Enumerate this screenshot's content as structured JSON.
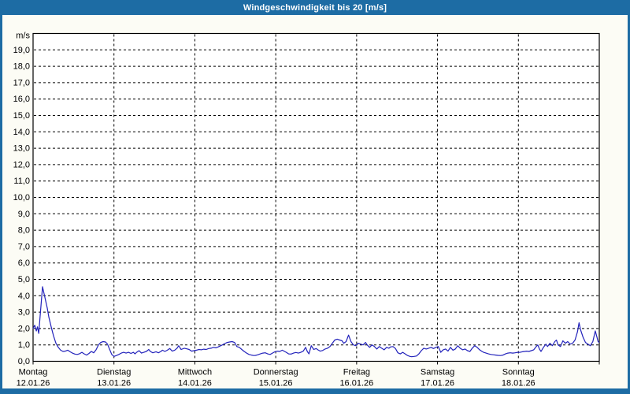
{
  "window": {
    "title": "Windgeschwindigkeit bis 20 [m/s]",
    "frame_color": "#1d6ca4",
    "content_background": "#fcfcf5"
  },
  "chart_data": {
    "type": "line",
    "title": "Windgeschwindigkeit bis 20 [m/s]",
    "unit_label": "m/s",
    "ylim": [
      0,
      20
    ],
    "y_tick_step": 1,
    "y_tick_labels": [
      "0,0",
      "1,0",
      "2,0",
      "3,0",
      "4,0",
      "5,0",
      "6,0",
      "7,0",
      "8,0",
      "9,0",
      "10,0",
      "11,0",
      "12,0",
      "13,0",
      "14,0",
      "15,0",
      "16,0",
      "17,0",
      "18,0",
      "19,0"
    ],
    "grid": "dashed",
    "legend_position": "none",
    "line_color": "#2222bb",
    "plot_background": "#ffffff",
    "x_days": [
      {
        "weekday": "Montag",
        "date": "12.01.26"
      },
      {
        "weekday": "Dienstag",
        "date": "13.01.26"
      },
      {
        "weekday": "Mittwoch",
        "date": "14.01.26"
      },
      {
        "weekday": "Donnerstag",
        "date": "15.01.26"
      },
      {
        "weekday": "Freitag",
        "date": "16.01.26"
      },
      {
        "weekday": "Samstag",
        "date": "17.01.26"
      },
      {
        "weekday": "Sonntag",
        "date": "18.01.26"
      }
    ],
    "series": [
      {
        "name": "Windgeschwindigkeit",
        "x_unit": "days_from_start",
        "y_unit": "m/s",
        "points": [
          [
            0.0,
            2.0
          ],
          [
            0.02,
            2.2
          ],
          [
            0.04,
            1.85
          ],
          [
            0.055,
            2.1
          ],
          [
            0.07,
            1.7
          ],
          [
            0.09,
            2.9
          ],
          [
            0.117,
            4.55
          ],
          [
            0.146,
            3.9
          ],
          [
            0.175,
            3.25
          ],
          [
            0.195,
            2.7
          ],
          [
            0.224,
            2.1
          ],
          [
            0.253,
            1.55
          ],
          [
            0.282,
            1.1
          ],
          [
            0.312,
            0.85
          ],
          [
            0.341,
            0.68
          ],
          [
            0.37,
            0.6
          ],
          [
            0.399,
            0.62
          ],
          [
            0.428,
            0.68
          ],
          [
            0.458,
            0.58
          ],
          [
            0.487,
            0.5
          ],
          [
            0.516,
            0.44
          ],
          [
            0.545,
            0.42
          ],
          [
            0.574,
            0.46
          ],
          [
            0.604,
            0.55
          ],
          [
            0.633,
            0.45
          ],
          [
            0.662,
            0.38
          ],
          [
            0.691,
            0.48
          ],
          [
            0.72,
            0.6
          ],
          [
            0.75,
            0.52
          ],
          [
            0.779,
            0.7
          ],
          [
            0.808,
            1.0
          ],
          [
            0.837,
            1.15
          ],
          [
            0.866,
            1.2
          ],
          [
            0.896,
            1.18
          ],
          [
            0.92,
            1.05
          ],
          [
            0.944,
            0.75
          ],
          [
            0.973,
            0.42
          ],
          [
            1.0,
            0.3
          ],
          [
            1.03,
            0.35
          ],
          [
            1.06,
            0.42
          ],
          [
            1.09,
            0.5
          ],
          [
            1.12,
            0.55
          ],
          [
            1.15,
            0.5
          ],
          [
            1.18,
            0.55
          ],
          [
            1.21,
            0.48
          ],
          [
            1.24,
            0.55
          ],
          [
            1.26,
            0.45
          ],
          [
            1.28,
            0.55
          ],
          [
            1.31,
            0.65
          ],
          [
            1.34,
            0.5
          ],
          [
            1.37,
            0.55
          ],
          [
            1.4,
            0.6
          ],
          [
            1.43,
            0.72
          ],
          [
            1.45,
            0.6
          ],
          [
            1.48,
            0.52
          ],
          [
            1.52,
            0.58
          ],
          [
            1.55,
            0.52
          ],
          [
            1.58,
            0.6
          ],
          [
            1.6,
            0.68
          ],
          [
            1.63,
            0.6
          ],
          [
            1.66,
            0.68
          ],
          [
            1.69,
            0.78
          ],
          [
            1.72,
            0.62
          ],
          [
            1.75,
            0.68
          ],
          [
            1.78,
            0.8
          ],
          [
            1.8,
            0.95
          ],
          [
            1.83,
            0.72
          ],
          [
            1.87,
            0.8
          ],
          [
            1.9,
            0.76
          ],
          [
            1.93,
            0.72
          ],
          [
            1.96,
            0.62
          ],
          [
            1.99,
            0.65
          ],
          [
            2.02,
            0.68
          ],
          [
            2.05,
            0.72
          ],
          [
            2.08,
            0.7
          ],
          [
            2.11,
            0.74
          ],
          [
            2.14,
            0.72
          ],
          [
            2.17,
            0.78
          ],
          [
            2.2,
            0.8
          ],
          [
            2.23,
            0.85
          ],
          [
            2.26,
            0.82
          ],
          [
            2.29,
            0.88
          ],
          [
            2.32,
            0.95
          ],
          [
            2.34,
            1.0
          ],
          [
            2.37,
            1.08
          ],
          [
            2.4,
            1.15
          ],
          [
            2.43,
            1.18
          ],
          [
            2.46,
            1.2
          ],
          [
            2.49,
            1.15
          ],
          [
            2.52,
            0.9
          ],
          [
            2.55,
            0.85
          ],
          [
            2.58,
            0.72
          ],
          [
            2.61,
            0.6
          ],
          [
            2.64,
            0.5
          ],
          [
            2.67,
            0.42
          ],
          [
            2.7,
            0.38
          ],
          [
            2.73,
            0.35
          ],
          [
            2.75,
            0.36
          ],
          [
            2.78,
            0.4
          ],
          [
            2.81,
            0.45
          ],
          [
            2.84,
            0.5
          ],
          [
            2.87,
            0.52
          ],
          [
            2.9,
            0.45
          ],
          [
            2.93,
            0.42
          ],
          [
            2.96,
            0.5
          ],
          [
            2.99,
            0.58
          ],
          [
            3.02,
            0.62
          ],
          [
            3.05,
            0.6
          ],
          [
            3.08,
            0.68
          ],
          [
            3.11,
            0.6
          ],
          [
            3.13,
            0.55
          ],
          [
            3.16,
            0.45
          ],
          [
            3.19,
            0.44
          ],
          [
            3.22,
            0.5
          ],
          [
            3.25,
            0.54
          ],
          [
            3.28,
            0.5
          ],
          [
            3.31,
            0.55
          ],
          [
            3.34,
            0.62
          ],
          [
            3.37,
            0.85
          ],
          [
            3.39,
            0.6
          ],
          [
            3.41,
            0.45
          ],
          [
            3.44,
            0.95
          ],
          [
            3.47,
            0.72
          ],
          [
            3.5,
            0.78
          ],
          [
            3.52,
            0.7
          ],
          [
            3.55,
            0.62
          ],
          [
            3.58,
            0.66
          ],
          [
            3.61,
            0.75
          ],
          [
            3.64,
            0.8
          ],
          [
            3.67,
            0.9
          ],
          [
            3.7,
            1.1
          ],
          [
            3.73,
            1.3
          ],
          [
            3.76,
            1.35
          ],
          [
            3.79,
            1.3
          ],
          [
            3.82,
            1.25
          ],
          [
            3.84,
            1.1
          ],
          [
            3.87,
            1.2
          ],
          [
            3.9,
            1.6
          ],
          [
            3.93,
            1.2
          ],
          [
            3.96,
            1.0
          ],
          [
            3.99,
            0.95
          ],
          [
            4.02,
            1.1
          ],
          [
            4.05,
            1.05
          ],
          [
            4.08,
            1.0
          ],
          [
            4.11,
            1.15
          ],
          [
            4.13,
            1.0
          ],
          [
            4.16,
            0.85
          ],
          [
            4.19,
            1.0
          ],
          [
            4.22,
            0.9
          ],
          [
            4.25,
            0.75
          ],
          [
            4.28,
            0.9
          ],
          [
            4.31,
            0.8
          ],
          [
            4.34,
            0.7
          ],
          [
            4.37,
            0.85
          ],
          [
            4.4,
            0.8
          ],
          [
            4.42,
            0.88
          ],
          [
            4.45,
            0.9
          ],
          [
            4.48,
            0.78
          ],
          [
            4.51,
            0.52
          ],
          [
            4.54,
            0.45
          ],
          [
            4.57,
            0.55
          ],
          [
            4.6,
            0.45
          ],
          [
            4.63,
            0.35
          ],
          [
            4.66,
            0.3
          ],
          [
            4.68,
            0.28
          ],
          [
            4.71,
            0.3
          ],
          [
            4.74,
            0.32
          ],
          [
            4.77,
            0.45
          ],
          [
            4.8,
            0.65
          ],
          [
            4.83,
            0.8
          ],
          [
            4.86,
            0.75
          ],
          [
            4.89,
            0.8
          ],
          [
            4.92,
            0.85
          ],
          [
            4.95,
            0.78
          ],
          [
            4.98,
            0.85
          ],
          [
            5.01,
            0.9
          ],
          [
            5.04,
            0.55
          ],
          [
            5.07,
            0.7
          ],
          [
            5.1,
            0.75
          ],
          [
            5.13,
            0.62
          ],
          [
            5.16,
            0.85
          ],
          [
            5.19,
            0.68
          ],
          [
            5.22,
            0.75
          ],
          [
            5.25,
            0.95
          ],
          [
            5.28,
            0.8
          ],
          [
            5.31,
            0.7
          ],
          [
            5.34,
            0.75
          ],
          [
            5.37,
            0.65
          ],
          [
            5.4,
            0.6
          ],
          [
            5.43,
            0.8
          ],
          [
            5.46,
            0.95
          ],
          [
            5.49,
            0.85
          ],
          [
            5.52,
            0.7
          ],
          [
            5.55,
            0.6
          ],
          [
            5.57,
            0.55
          ],
          [
            5.6,
            0.5
          ],
          [
            5.63,
            0.45
          ],
          [
            5.66,
            0.42
          ],
          [
            5.69,
            0.4
          ],
          [
            5.72,
            0.38
          ],
          [
            5.75,
            0.36
          ],
          [
            5.78,
            0.35
          ],
          [
            5.81,
            0.38
          ],
          [
            5.84,
            0.45
          ],
          [
            5.87,
            0.5
          ],
          [
            5.9,
            0.52
          ],
          [
            5.93,
            0.5
          ],
          [
            5.96,
            0.52
          ],
          [
            5.99,
            0.55
          ],
          [
            6.02,
            0.55
          ],
          [
            6.05,
            0.58
          ],
          [
            6.08,
            0.6
          ],
          [
            6.1,
            0.62
          ],
          [
            6.13,
            0.6
          ],
          [
            6.16,
            0.65
          ],
          [
            6.19,
            0.7
          ],
          [
            6.22,
            0.9
          ],
          [
            6.24,
            1.0
          ],
          [
            6.26,
            0.75
          ],
          [
            6.28,
            0.6
          ],
          [
            6.31,
            0.85
          ],
          [
            6.34,
            1.05
          ],
          [
            6.36,
            0.9
          ],
          [
            6.39,
            1.1
          ],
          [
            6.42,
            0.95
          ],
          [
            6.45,
            1.2
          ],
          [
            6.47,
            1.3
          ],
          [
            6.49,
            1.0
          ],
          [
            6.52,
            0.9
          ],
          [
            6.55,
            1.25
          ],
          [
            6.58,
            1.1
          ],
          [
            6.61,
            1.2
          ],
          [
            6.64,
            1.05
          ],
          [
            6.67,
            1.1
          ],
          [
            6.7,
            1.3
          ],
          [
            6.73,
            1.8
          ],
          [
            6.75,
            2.35
          ],
          [
            6.77,
            1.9
          ],
          [
            6.8,
            1.45
          ],
          [
            6.83,
            1.15
          ],
          [
            6.86,
            1.05
          ],
          [
            6.89,
            0.95
          ],
          [
            6.92,
            1.2
          ],
          [
            6.95,
            1.85
          ],
          [
            6.97,
            1.5
          ],
          [
            6.985,
            1.2
          ],
          [
            7.0,
            1.15
          ]
        ]
      }
    ]
  }
}
